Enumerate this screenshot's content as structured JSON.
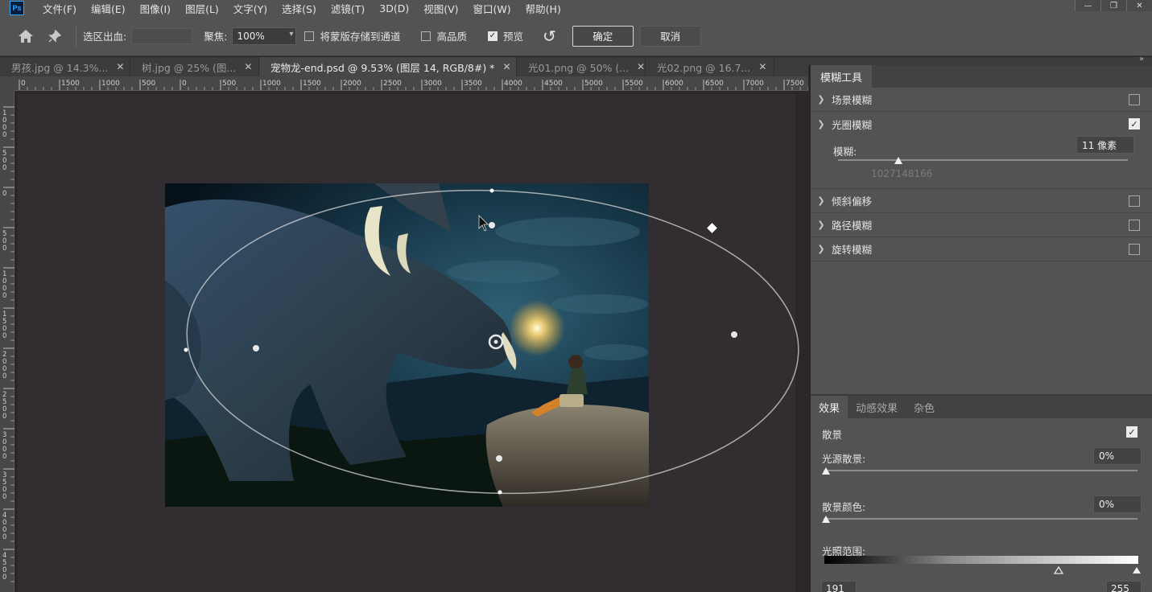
{
  "app": {
    "logo": "Ps"
  },
  "menu": [
    "文件(F)",
    "编辑(E)",
    "图像(I)",
    "图层(L)",
    "文字(Y)",
    "选择(S)",
    "滤镜(T)",
    "3D(D)",
    "视图(V)",
    "窗口(W)",
    "帮助(H)"
  ],
  "window_controls": [
    "—",
    "❐",
    "✕"
  ],
  "options": {
    "home_icon": "home-icon",
    "pin_icon": "pin-icon",
    "selection_bleed_label": "选区出血:",
    "focus_label": "聚焦:",
    "focus_value": "100%",
    "save_mask_label": "将蒙版存储到通道",
    "save_mask_checked": false,
    "high_quality_label": "高品质",
    "high_quality_checked": false,
    "preview_label": "预览",
    "preview_checked": true,
    "ok_label": "确定",
    "cancel_label": "取消"
  },
  "tabs": [
    {
      "label": "男孩.jpg @ 14.3%...",
      "active": false
    },
    {
      "label": "树.jpg @ 25% (图...",
      "active": false
    },
    {
      "label": "宠物龙-end.psd @ 9.53% (图层 14, RGB/8#) *",
      "active": true
    },
    {
      "label": "光01.png @ 50% (...",
      "active": false
    },
    {
      "label": "光02.png @ 16.7...",
      "active": false
    }
  ],
  "ruler_h_labels": [
    "0",
    "1500",
    "1000",
    "500",
    "0",
    "500",
    "1000",
    "1500",
    "2000",
    "2500",
    "3000",
    "3500",
    "4000",
    "4500",
    "5000",
    "5500",
    "6000",
    "6500",
    "7000",
    "7500"
  ],
  "ruler_v_labels": [
    "1000",
    "500",
    "0",
    "500",
    "1000",
    "1500",
    "2000",
    "2500",
    "3000",
    "3500",
    "4000",
    "4500"
  ],
  "blur_panel": {
    "tab": "模糊工具",
    "items": [
      {
        "label": "场景模糊",
        "expanded": false,
        "checked": false
      },
      {
        "label": "光圈模糊",
        "expanded": true,
        "checked": true
      },
      {
        "label": "倾斜偏移",
        "expanded": false,
        "checked": false
      },
      {
        "label": "路径模糊",
        "expanded": false,
        "checked": false
      },
      {
        "label": "旋转模糊",
        "expanded": false,
        "checked": false
      }
    ],
    "iris": {
      "label": "模糊:",
      "value": "11 像素",
      "level": 0.2,
      "ghost_text": "1027148166"
    }
  },
  "effects_panel": {
    "tabs": [
      "效果",
      "动感效果",
      "杂色"
    ],
    "active_tab": "效果",
    "bokeh_label": "散景",
    "bokeh_checked": true,
    "light_bokeh_label": "光源散景:",
    "light_bokeh_value": "0%",
    "bokeh_color_label": "散景颜色:",
    "bokeh_color_value": "0%",
    "light_range_label": "光照范围:",
    "light_range_low": "191",
    "light_range_high": "255"
  },
  "colors": {
    "accent": "#31a8ff",
    "chrome": "#535353",
    "canvas": "#2a2629"
  }
}
